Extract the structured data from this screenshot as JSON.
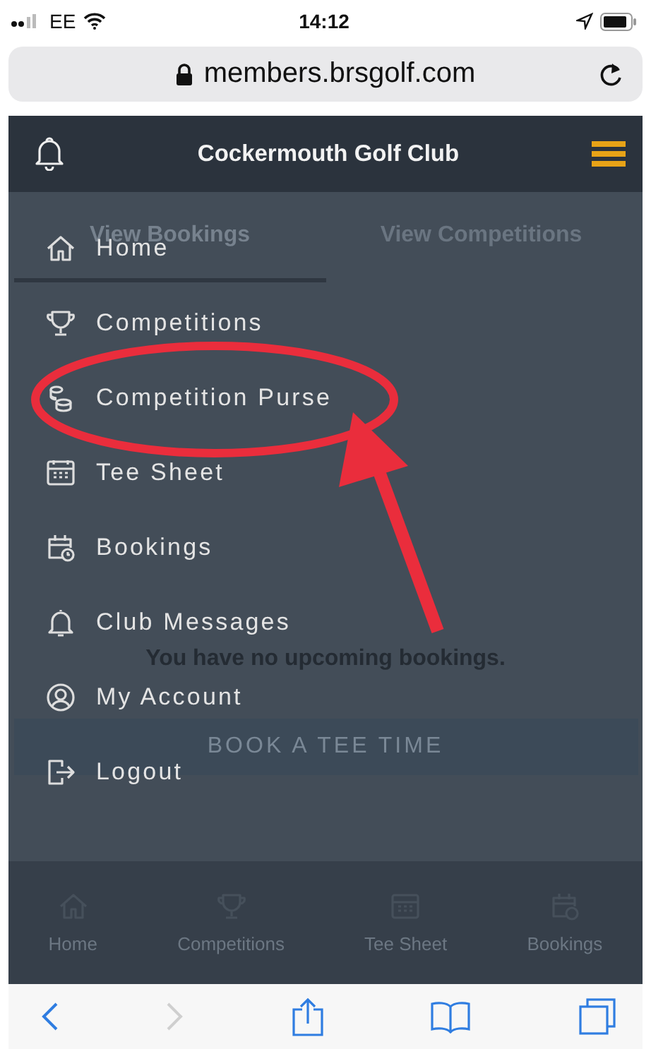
{
  "status_bar": {
    "carrier": "EE",
    "time": "14:12"
  },
  "browser": {
    "url": "members.brsgolf.com"
  },
  "header": {
    "title": "Cockermouth Golf Club"
  },
  "menu": {
    "items": [
      {
        "label": "Home"
      },
      {
        "label": "Competitions"
      },
      {
        "label": "Competition Purse"
      },
      {
        "label": "Tee Sheet"
      },
      {
        "label": "Bookings"
      },
      {
        "label": "Club Messages"
      },
      {
        "label": "My Account"
      },
      {
        "label": "Logout"
      }
    ]
  },
  "page": {
    "tabs": [
      {
        "label": "View Bookings",
        "selected": true
      },
      {
        "label": "View Competitions",
        "selected": false
      }
    ],
    "message": "You have no upcoming bookings.",
    "button": "BOOK A TEE TIME"
  },
  "bottom_nav": [
    {
      "label": "Home"
    },
    {
      "label": "Competitions"
    },
    {
      "label": "Tee Sheet"
    },
    {
      "label": "Bookings"
    }
  ]
}
